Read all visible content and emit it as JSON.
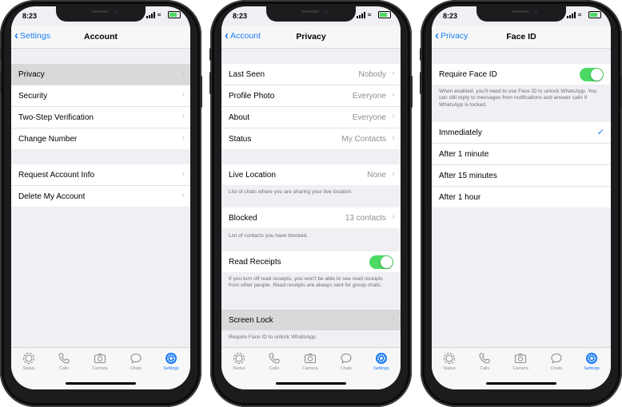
{
  "status_time": "8:23",
  "colors": {
    "accent": "#1b7cf5",
    "toggle_on": "#4cd964",
    "selected_row": "#d9d9d9"
  },
  "tabs": [
    "Status",
    "Calls",
    "Camera",
    "Chats",
    "Settings"
  ],
  "account": {
    "back": "Settings",
    "title": "Account",
    "group1": [
      "Privacy",
      "Security",
      "Two-Step Verification",
      "Change Number"
    ],
    "group2": [
      "Request Account Info",
      "Delete My Account"
    ]
  },
  "privacy": {
    "back": "Account",
    "title": "Privacy",
    "rows": [
      {
        "label": "Last Seen",
        "value": "Nobody"
      },
      {
        "label": "Profile Photo",
        "value": "Everyone"
      },
      {
        "label": "About",
        "value": "Everyone"
      },
      {
        "label": "Status",
        "value": "My Contacts"
      }
    ],
    "live_location": {
      "label": "Live Location",
      "value": "None",
      "footer": "List of chats where you are sharing your live location."
    },
    "blocked": {
      "label": "Blocked",
      "value": "13 contacts",
      "footer": "List of contacts you have blocked."
    },
    "read_receipts": {
      "label": "Read Receipts",
      "on": true,
      "footer": "If you turn off read receipts, you won't be able to see read receipts from other people. Read receipts are always sent for group chats."
    },
    "screen_lock": {
      "label": "Screen Lock",
      "footer": "Require Face ID to unlock WhatsApp."
    }
  },
  "faceid": {
    "back": "Privacy",
    "title": "Face ID",
    "require": {
      "label": "Require Face ID",
      "on": true
    },
    "footer": "When enabled, you'll need to use Face ID to unlock WhatsApp. You can still reply to messages from notifications and answer calls if WhatsApp is locked.",
    "options": [
      "Immediately",
      "After 1 minute",
      "After 15 minutes",
      "After 1 hour"
    ],
    "selected_option": "Immediately"
  }
}
